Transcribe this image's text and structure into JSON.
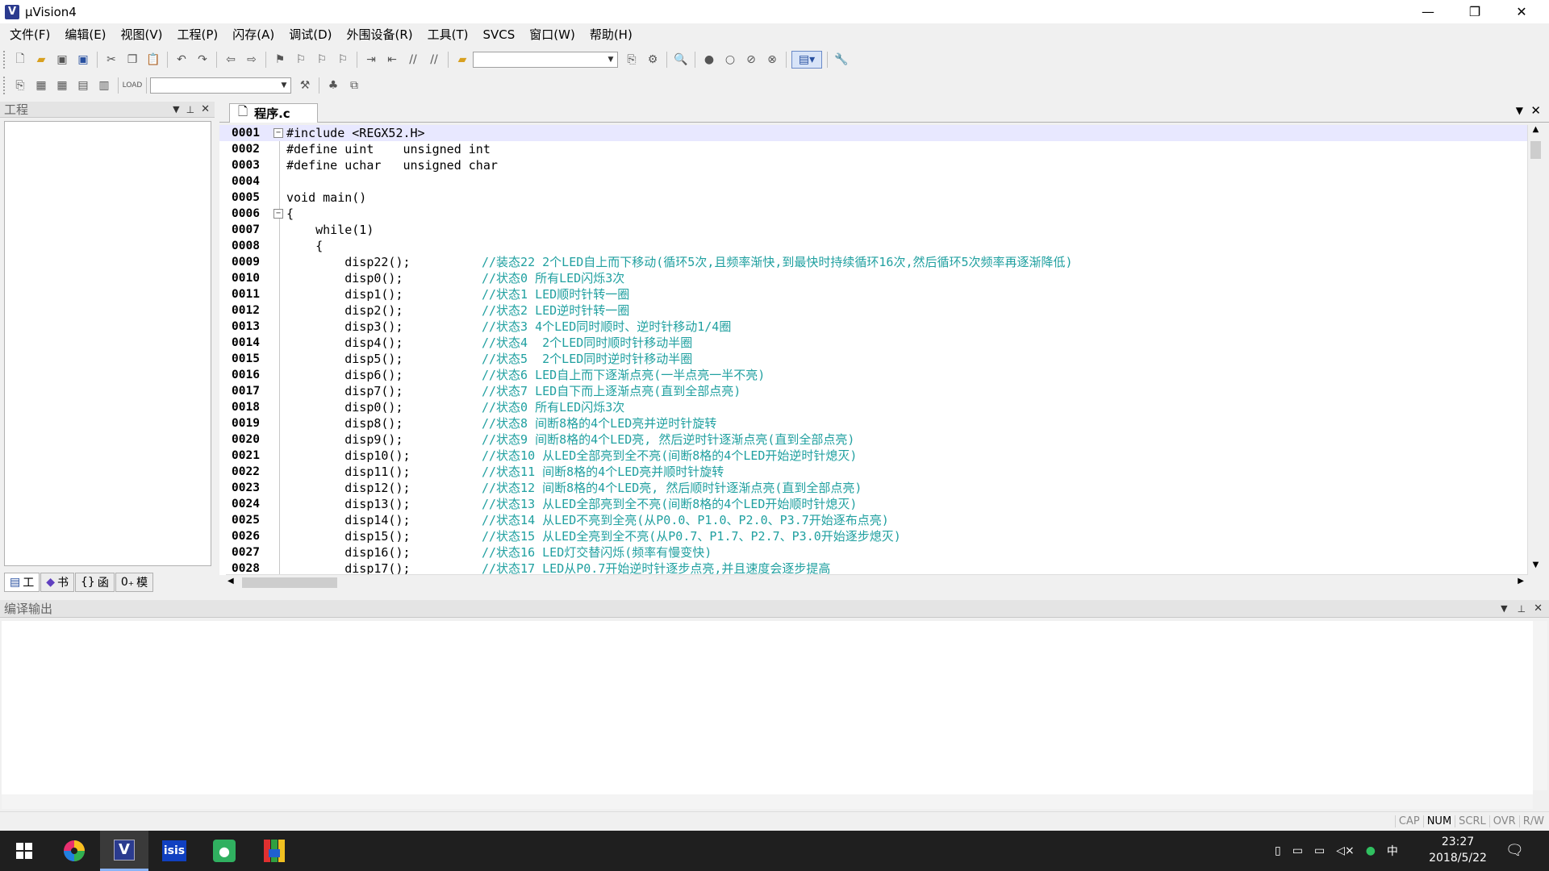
{
  "window": {
    "title": "µVision4",
    "minimize": "—",
    "maximize": "❐",
    "close": "✕"
  },
  "menu": [
    "文件(F)",
    "编辑(E)",
    "视图(V)",
    "工程(P)",
    "闪存(A)",
    "调试(D)",
    "外围设备(R)",
    "工具(T)",
    "SVCS",
    "窗口(W)",
    "帮助(H)"
  ],
  "project_panel": {
    "title": "工程",
    "tabs": [
      "工",
      "书",
      "函",
      "模"
    ]
  },
  "editor": {
    "tab_label": "程序.c",
    "lines": [
      {
        "n": "0001",
        "code": "#include <REGX52.H>",
        "comment": ""
      },
      {
        "n": "0002",
        "code": "#define uint    unsigned int",
        "comment": ""
      },
      {
        "n": "0003",
        "code": "#define uchar   unsigned char",
        "comment": ""
      },
      {
        "n": "0004",
        "code": "",
        "comment": ""
      },
      {
        "n": "0005",
        "code": "void main()",
        "comment": ""
      },
      {
        "n": "0006",
        "code": "{",
        "comment": ""
      },
      {
        "n": "0007",
        "code": "    while(1)",
        "comment": ""
      },
      {
        "n": "0008",
        "code": "    {",
        "comment": ""
      },
      {
        "n": "0009",
        "code": "        disp22();",
        "comment": "//装态22 2个LED自上而下移动(循环5次,且频率渐快,到最快时持续循环16次,然后循环5次频率再逐渐降低)"
      },
      {
        "n": "0010",
        "code": "        disp0();",
        "comment": "//状态0 所有LED闪烁3次"
      },
      {
        "n": "0011",
        "code": "        disp1();",
        "comment": "//状态1 LED顺时针转一圈"
      },
      {
        "n": "0012",
        "code": "        disp2();",
        "comment": "//状态2 LED逆时针转一圈"
      },
      {
        "n": "0013",
        "code": "        disp3();",
        "comment": "//状态3 4个LED同时顺时、逆时针移动1/4圈"
      },
      {
        "n": "0014",
        "code": "        disp4();",
        "comment": "//状态4  2个LED同时顺时针移动半圈"
      },
      {
        "n": "0015",
        "code": "        disp5();",
        "comment": "//状态5  2个LED同时逆时针移动半圈"
      },
      {
        "n": "0016",
        "code": "        disp6();",
        "comment": "//状态6 LED自上而下逐渐点亮(一半点亮一半不亮)"
      },
      {
        "n": "0017",
        "code": "        disp7();",
        "comment": "//状态7 LED自下而上逐渐点亮(直到全部点亮)"
      },
      {
        "n": "0018",
        "code": "        disp0();",
        "comment": "//状态0 所有LED闪烁3次"
      },
      {
        "n": "0019",
        "code": "        disp8();",
        "comment": "//状态8 间断8格的4个LED亮并逆时针旋转"
      },
      {
        "n": "0020",
        "code": "        disp9();",
        "comment": "//状态9 间断8格的4个LED亮, 然后逆时针逐渐点亮(直到全部点亮)"
      },
      {
        "n": "0021",
        "code": "        disp10();",
        "comment": "//状态10 从LED全部亮到全不亮(间断8格的4个LED开始逆时针熄灭)"
      },
      {
        "n": "0022",
        "code": "        disp11();",
        "comment": "//状态11 间断8格的4个LED亮并顺时针旋转"
      },
      {
        "n": "0023",
        "code": "        disp12();",
        "comment": "//状态12 间断8格的4个LED亮, 然后顺时针逐渐点亮(直到全部点亮)"
      },
      {
        "n": "0024",
        "code": "        disp13();",
        "comment": "//状态13 从LED全部亮到全不亮(间断8格的4个LED开始顺时针熄灭)"
      },
      {
        "n": "0025",
        "code": "        disp14();",
        "comment": "//状态14 从LED不亮到全亮(从P0.0、P1.0、P2.0、P3.7开始逐布点亮)"
      },
      {
        "n": "0026",
        "code": "        disp15();",
        "comment": "//状态15 从LED全亮到全不亮(从P0.7、P1.7、P2.7、P3.0开始逐步熄灭)"
      },
      {
        "n": "0027",
        "code": "        disp16();",
        "comment": "//状态16 LED灯交替闪烁(频率有慢变快)"
      },
      {
        "n": "0028",
        "code": "        disp17();",
        "comment": "//状态17 LED从P0.7开始逆时针逐步点亮,并且速度会逐步提高"
      }
    ]
  },
  "output_panel": {
    "title": "编译输出"
  },
  "status": [
    "CAP",
    "NUM",
    "SCRL",
    "OVR",
    "R/W"
  ],
  "status_active": "NUM",
  "tray": {
    "ime": "中",
    "time": "23:27",
    "date": "2018/5/22"
  }
}
